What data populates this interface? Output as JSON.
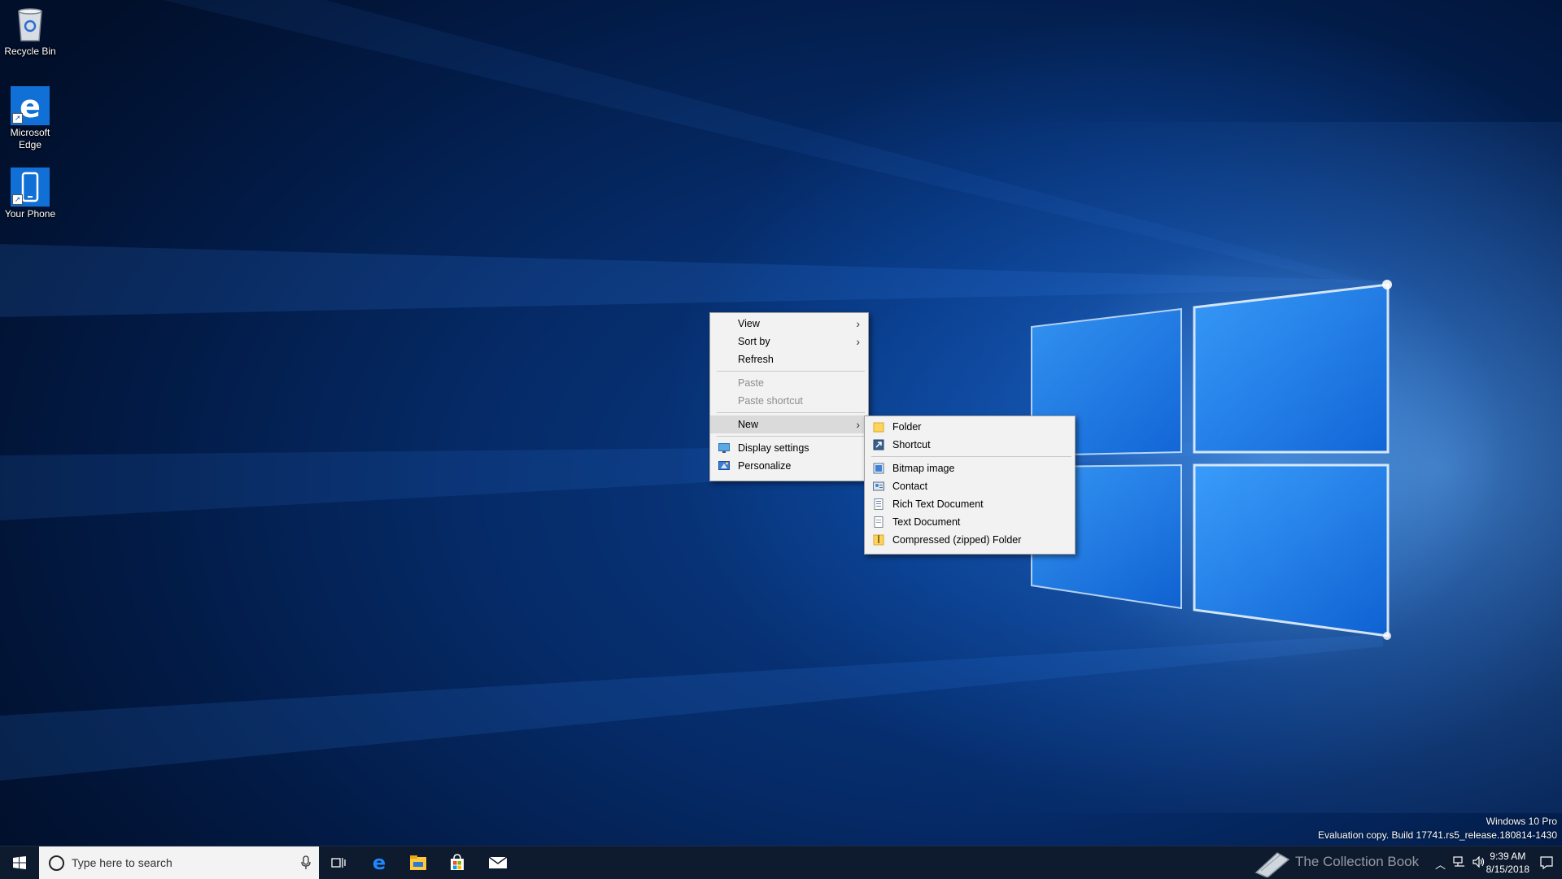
{
  "desktop": {
    "icons": [
      {
        "name": "recycle-bin",
        "label": "Recycle Bin"
      },
      {
        "name": "microsoft-edge",
        "label": "Microsoft Edge"
      },
      {
        "name": "your-phone",
        "label": "Your Phone"
      }
    ]
  },
  "context_menu": {
    "items": [
      {
        "label": "View",
        "submenu": true,
        "enabled": true
      },
      {
        "label": "Sort by",
        "submenu": true,
        "enabled": true
      },
      {
        "label": "Refresh",
        "submenu": false,
        "enabled": true
      },
      {
        "label": "Paste",
        "submenu": false,
        "enabled": false
      },
      {
        "label": "Paste shortcut",
        "submenu": false,
        "enabled": false
      },
      {
        "label": "New",
        "submenu": true,
        "enabled": true,
        "highlighted": true
      },
      {
        "label": "Display settings",
        "icon": "display-settings-icon",
        "enabled": true
      },
      {
        "label": "Personalize",
        "icon": "personalize-icon",
        "enabled": true
      }
    ]
  },
  "new_submenu": {
    "items": [
      {
        "label": "Folder",
        "icon": "folder-icon"
      },
      {
        "label": "Shortcut",
        "icon": "shortcut-icon"
      },
      {
        "label": "Bitmap image",
        "icon": "bitmap-image-icon"
      },
      {
        "label": "Contact",
        "icon": "contact-icon"
      },
      {
        "label": "Rich Text Document",
        "icon": "rich-text-document-icon"
      },
      {
        "label": "Text Document",
        "icon": "text-document-icon"
      },
      {
        "label": "Compressed (zipped) Folder",
        "icon": "zipped-folder-icon"
      }
    ]
  },
  "watermark": {
    "edition": "Windows 10 Pro",
    "build": "Evaluation copy. Build 17741.rs5_release.180814-1430"
  },
  "taskbar": {
    "search_placeholder": "Type here to search",
    "pinned": [
      "task-view-icon",
      "edge-icon",
      "file-explorer-icon",
      "store-icon",
      "mail-icon"
    ],
    "overlay_text": "The Collection Book",
    "clock": {
      "time": "9:39 AM",
      "date": "8/15/2018"
    }
  },
  "colors": {
    "taskbar": "#0e1a2d",
    "menu_bg": "#f2f2f2",
    "menu_highlight": "#dadada",
    "disabled_text": "#8d8d8d"
  }
}
